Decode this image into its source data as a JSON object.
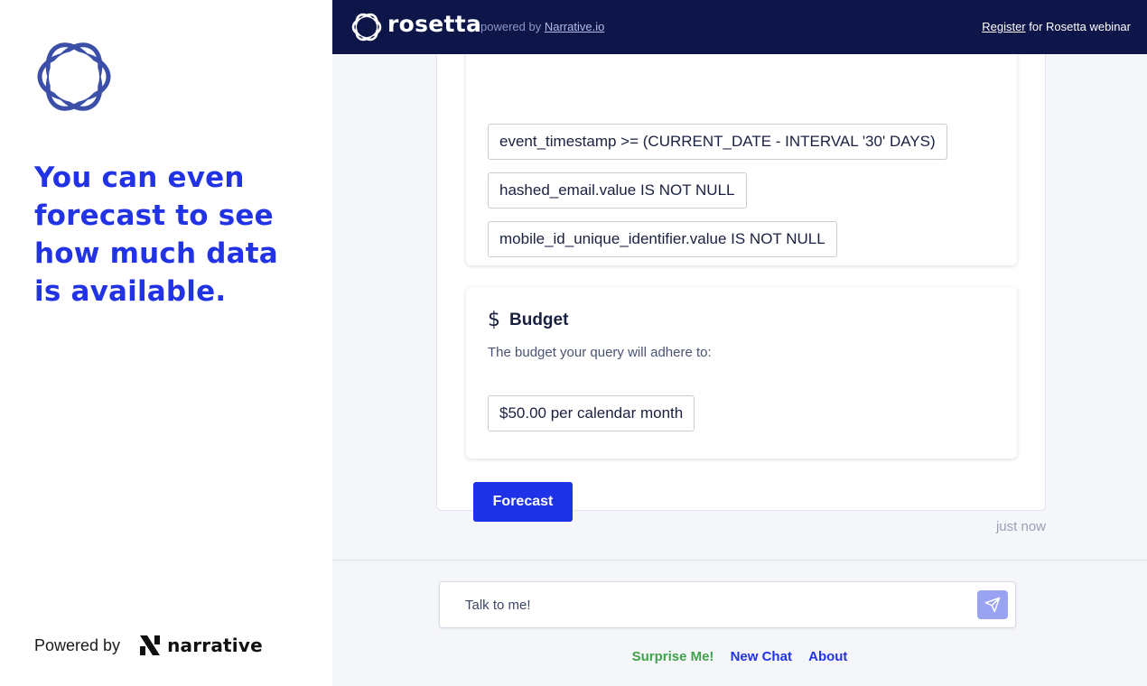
{
  "left": {
    "headline": "You can even forecast to see how much data is available.",
    "powered_label": "Powered by",
    "narrative_word": "narrative"
  },
  "topbar": {
    "brand": "rosetta",
    "powered_prefix": "powered by",
    "powered_link": "Narrative.io",
    "register_link": "Register",
    "register_suffix": "for Rosetta webinar"
  },
  "filters": {
    "chips": [
      "event_timestamp >= (CURRENT_DATE - INTERVAL '30' DAYS)",
      "hashed_email.value IS NOT NULL",
      "mobile_id_unique_identifier.value IS NOT NULL"
    ]
  },
  "budget": {
    "icon": "dollar-icon",
    "title": "Budget",
    "description": "The budget your query will adhere to:",
    "value": "$50.00 per calendar month"
  },
  "message": {
    "forecast_label": "Forecast",
    "timestamp": "just now"
  },
  "footer": {
    "input_placeholder": "Talk to me!",
    "links": {
      "surprise": "Surprise Me!",
      "new_chat": "New Chat",
      "about": "About"
    }
  },
  "colors": {
    "accent": "#1e33e8",
    "topbar": "#0d1549",
    "surprise": "#3fa34d"
  }
}
